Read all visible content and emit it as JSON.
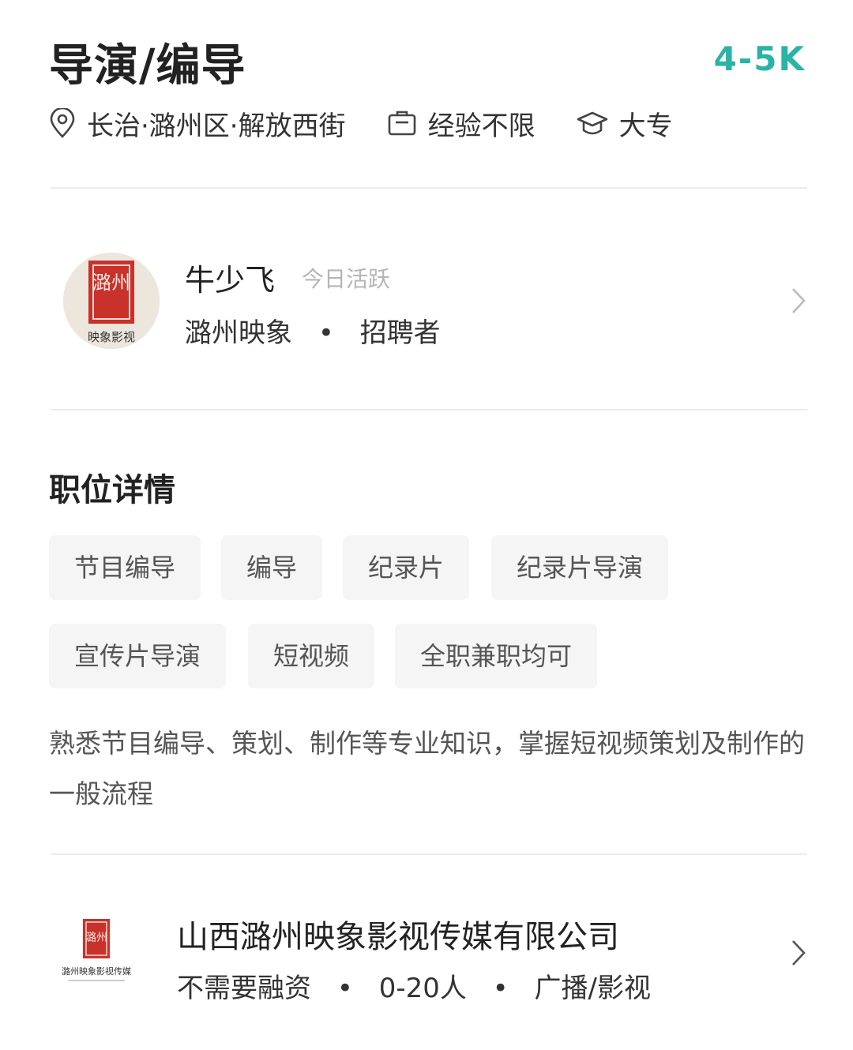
{
  "job": {
    "title": "导演/编导",
    "salary": "4-5K"
  },
  "meta": {
    "location": "长治·潞州区·解放西街",
    "experience": "经验不限",
    "education": "大专",
    "icons": [
      "location-pin-icon",
      "briefcase-icon",
      "graduation-cap-icon"
    ]
  },
  "recruiter": {
    "name": "牛少飞",
    "active_status": "今日活跃",
    "company_short": "潞州映象",
    "separator": "•",
    "role": "招聘者",
    "avatar_seal_text": "潞州",
    "avatar_caption": "映象影视"
  },
  "details": {
    "section_title": "职位详情",
    "tags": [
      "节目编导",
      "编导",
      "纪录片",
      "纪录片导演",
      "宣传片导演",
      "短视频",
      "全职兼职均可"
    ],
    "description": "熟悉节目编导、策划、制作等专业知识，掌握短视频策划及制作的一般流程"
  },
  "company": {
    "name": "山西潞州映象影视传媒有限公司",
    "funding": "不需要融资",
    "size": "0-20人",
    "industry": "广播/影视",
    "separator": "•",
    "logo_seal_text": "潞州",
    "logo_caption": "潞州映象影视传媒"
  },
  "colors": {
    "accent": "#2ab3a6",
    "text": "#222222",
    "muted": "#b5b5b5",
    "tag_bg": "#f5f5f5",
    "seal_red": "#c8322a"
  }
}
